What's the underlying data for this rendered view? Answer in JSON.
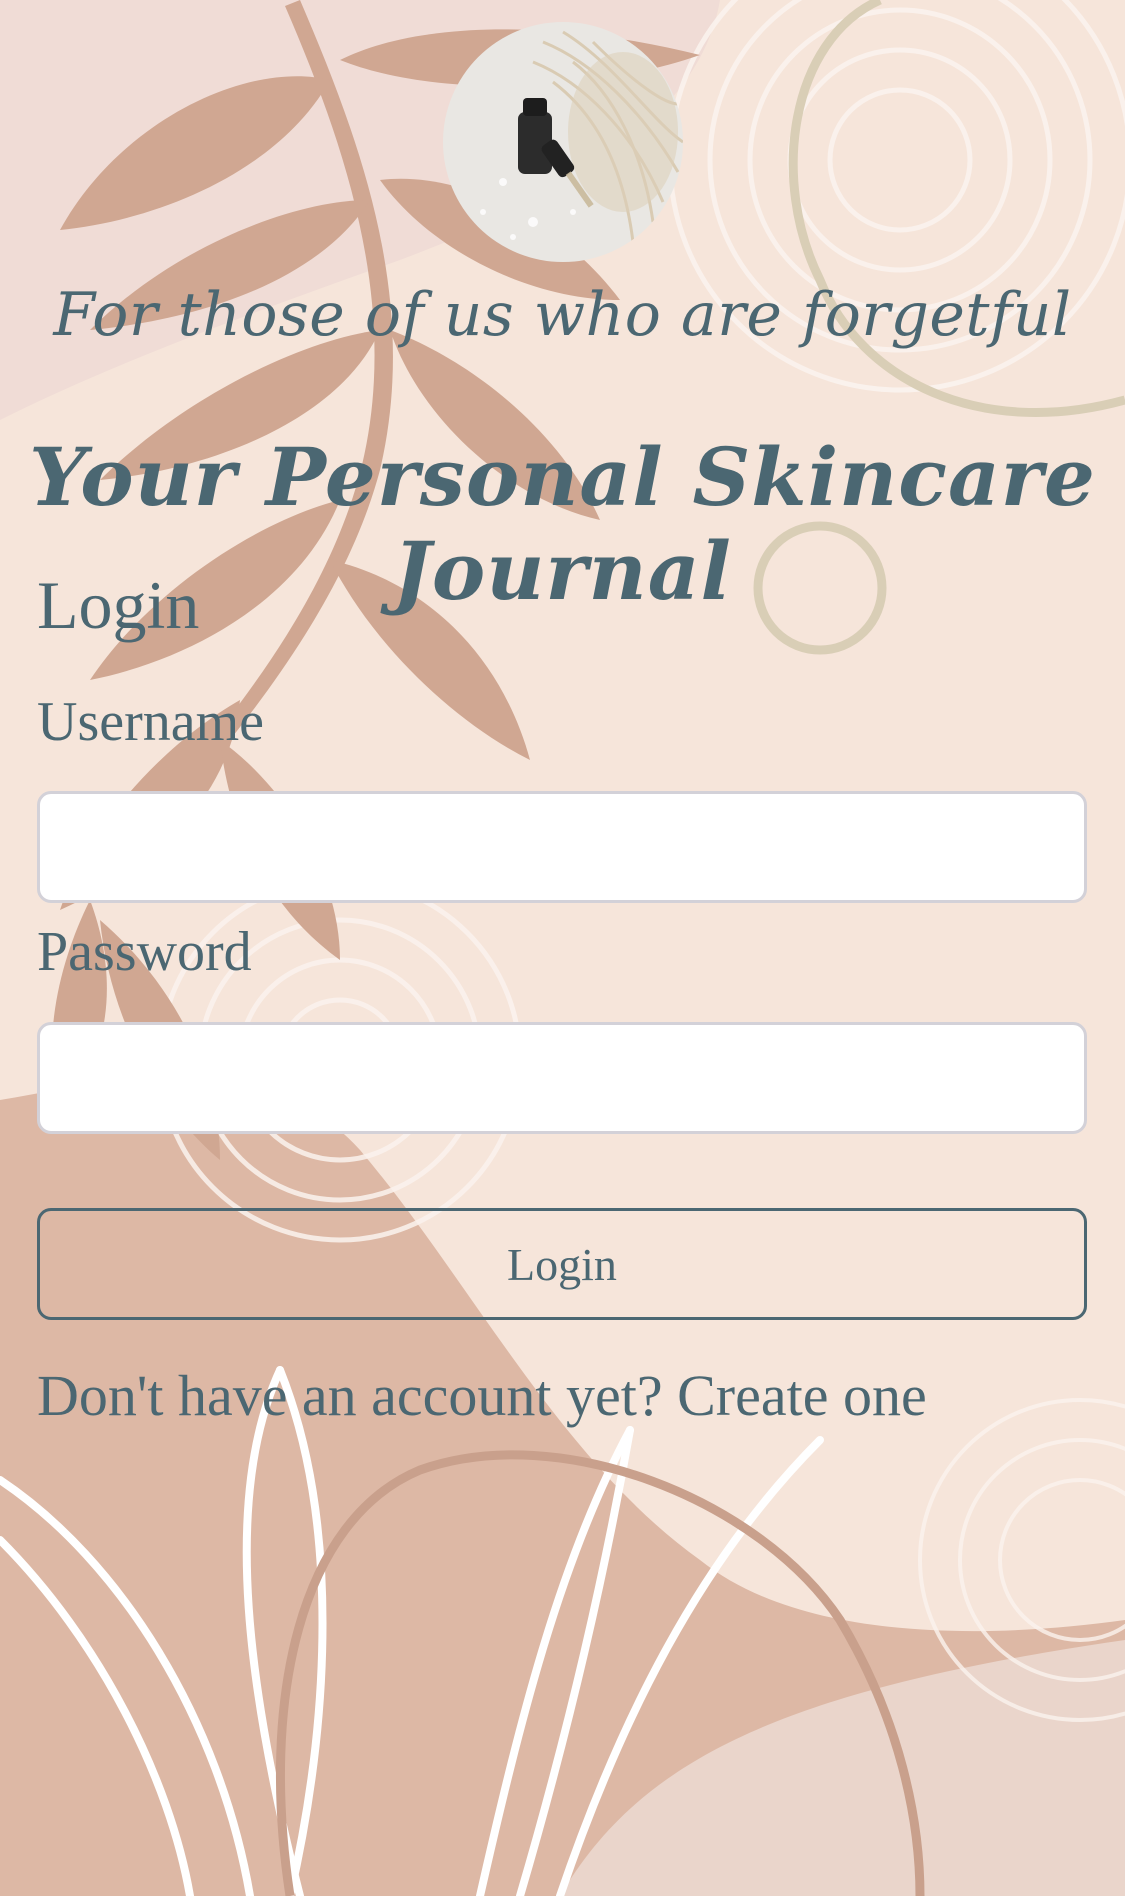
{
  "header": {
    "avatar_icon": "skincare-dropper-bottle-photo",
    "tagline": "For those of us who are forgetful",
    "title": "Your Personal Skincare Journal"
  },
  "login_form": {
    "heading": "Login",
    "username_label": "Username",
    "username_value": "",
    "password_label": "Password",
    "password_value": "",
    "submit_label": "Login"
  },
  "signup": {
    "prompt": "Don't have an account yet?",
    "link_label": "Create one"
  },
  "colors": {
    "text": "#4b6772",
    "background": "#f6e5da",
    "leaf": "#d0a792",
    "input_border": "#d3d1d8"
  }
}
